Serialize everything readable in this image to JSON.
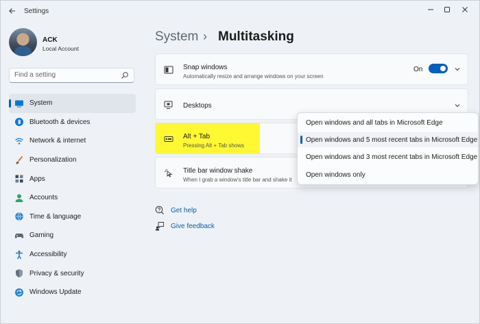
{
  "window": {
    "title": "Settings",
    "back_icon": "back-arrow-icon",
    "controls": [
      "minimize-icon",
      "maximize-icon",
      "close-icon"
    ]
  },
  "user": {
    "name": "ACK",
    "account_type": "Local Account"
  },
  "search": {
    "placeholder": "Find a setting"
  },
  "sidebar": {
    "items": [
      {
        "label": "System",
        "icon": "monitor-icon",
        "selected": true,
        "color": "#0078d4"
      },
      {
        "label": "Bluetooth & devices",
        "icon": "bluetooth-icon",
        "selected": false,
        "color": "#0078d4"
      },
      {
        "label": "Network & internet",
        "icon": "wifi-icon",
        "selected": false,
        "color": "#1a86d9"
      },
      {
        "label": "Personalization",
        "icon": "brush-icon",
        "selected": false,
        "color": "#d1783b"
      },
      {
        "label": "Apps",
        "icon": "apps-icon",
        "selected": false,
        "color": "#3b4a5a"
      },
      {
        "label": "Accounts",
        "icon": "person-icon",
        "selected": false,
        "color": "#2aa56c"
      },
      {
        "label": "Time & language",
        "icon": "globe-clock-icon",
        "selected": false,
        "color": "#2b87d1"
      },
      {
        "label": "Gaming",
        "icon": "gamepad-icon",
        "selected": false,
        "color": "#5c6670"
      },
      {
        "label": "Accessibility",
        "icon": "accessibility-icon",
        "selected": false,
        "color": "#1f73c4"
      },
      {
        "label": "Privacy & security",
        "icon": "shield-icon",
        "selected": false,
        "color": "#66717d"
      },
      {
        "label": "Windows Update",
        "icon": "update-icon",
        "selected": false,
        "color": "#1a86d9"
      }
    ]
  },
  "breadcrumb": {
    "parent": "System",
    "separator": "›",
    "current": "Multitasking"
  },
  "settings": {
    "snap": {
      "title": "Snap windows",
      "subtitle": "Automatically resize and arrange windows on your screen",
      "toggle_state": "On",
      "toggle_on": true
    },
    "desktops": {
      "title": "Desktops"
    },
    "alt_tab": {
      "title": "Alt + Tab",
      "subtitle": "Pressing Alt + Tab shows"
    },
    "shake": {
      "title": "Title bar window shake",
      "subtitle": "When I grab a window's title bar and shake it"
    }
  },
  "dropdown": {
    "options": [
      {
        "label": "Open windows and all tabs in Microsoft Edge",
        "selected": false
      },
      {
        "label": "Open windows and 5 most recent tabs in Microsoft Edge",
        "selected": true
      },
      {
        "label": "Open windows and 3 most recent tabs in Microsoft Edge",
        "selected": false
      },
      {
        "label": "Open windows only",
        "selected": false
      }
    ]
  },
  "links": {
    "help": "Get help",
    "feedback": "Give feedback"
  },
  "colors": {
    "accent": "#005fb8",
    "highlight": "#fff833",
    "link": "#0b5cab"
  }
}
